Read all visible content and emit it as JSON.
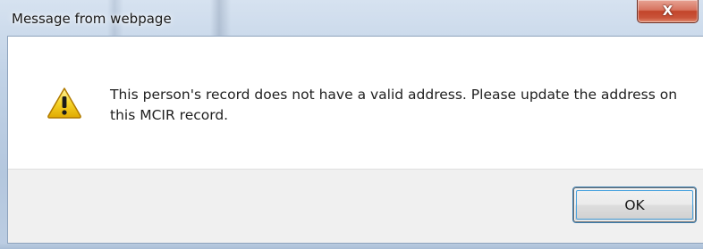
{
  "window": {
    "title": "Message from webpage",
    "close_glyph": "X"
  },
  "dialog": {
    "icon": "warning-icon",
    "message": "This person's record does not have a valid address. Please update the address on this MCIR record.",
    "ok_label": "OK"
  },
  "colors": {
    "close_button": "#c9543a",
    "warning_yellow": "#f5d020",
    "content_bg": "#ffffff",
    "footer_bg": "#f0f0f0",
    "focus_ring": "#3c7fb1"
  }
}
